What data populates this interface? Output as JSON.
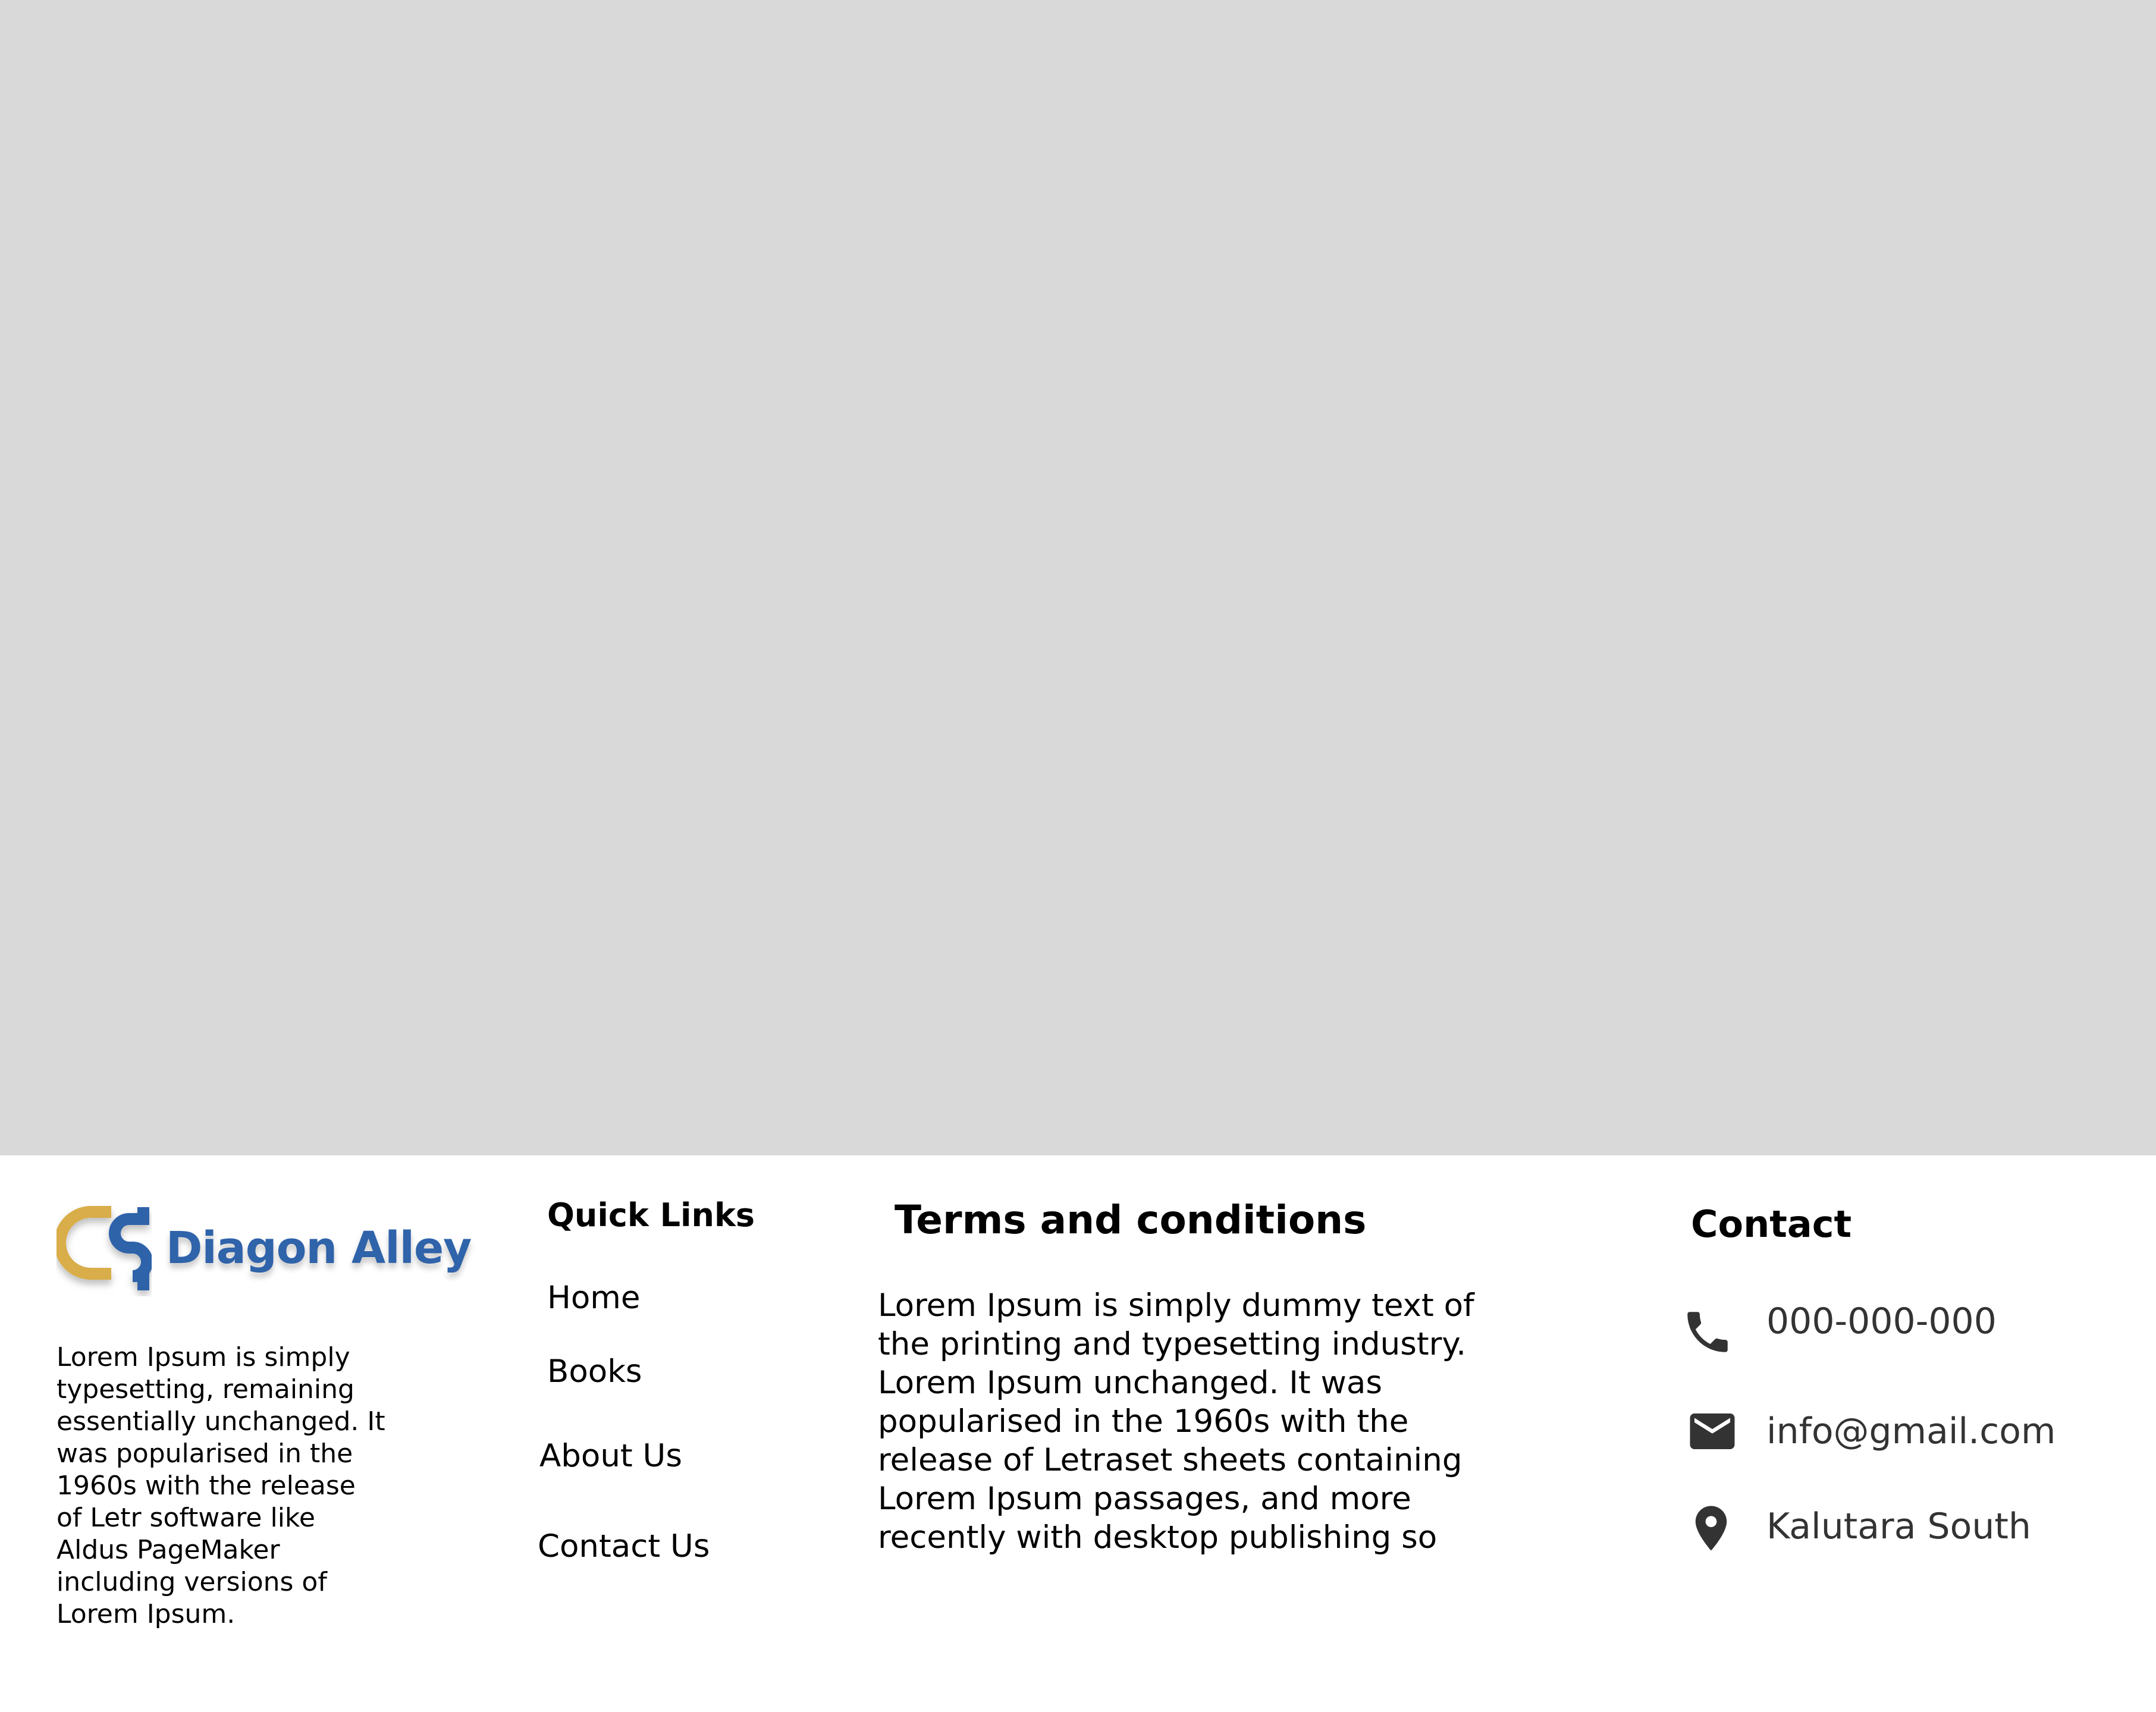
{
  "brand": {
    "name": "Diagon Alley",
    "logo_icon": "diagon-alley-logo",
    "colors": {
      "blue": "#2f63aa",
      "gold": "#d9ad4a"
    },
    "description": [
      "Lorem Ipsum is simply",
      "typesetting, remaining",
      "essentially unchanged. It",
      "was popularised in the",
      "1960s with the release",
      "of Letr software like",
      "Aldus PageMaker",
      "including versions of",
      "Lorem Ipsum."
    ]
  },
  "quick_links": {
    "heading": "Quick Links",
    "items": [
      "Home",
      "Books",
      "About Us",
      "Contact Us"
    ]
  },
  "terms": {
    "heading": "Terms and conditions",
    "lines": [
      "Lorem Ipsum is simply dummy text of",
      "the printing and typesetting industry.",
      "Lorem Ipsum  unchanged. It was",
      "popularised in the 1960s with the",
      "release of Letraset sheets containing",
      "Lorem Ipsum passages, and more",
      "recently with desktop publishing so"
    ]
  },
  "contact": {
    "heading": "Contact",
    "phone": "000-000-000",
    "email": "info@gmail.com",
    "location": "Kalutara South",
    "icons": [
      "phone-icon",
      "mail-icon",
      "location-pin-icon"
    ],
    "icon_color": "#333333"
  },
  "hero": {
    "background": "#d9d9d9"
  }
}
